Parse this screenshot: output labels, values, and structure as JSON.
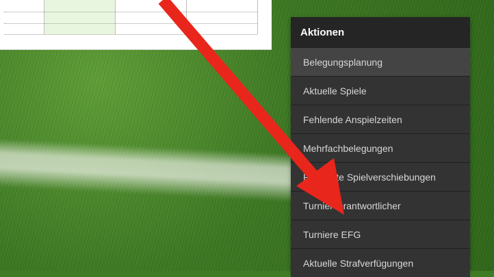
{
  "menu": {
    "title": "Aktionen",
    "items": [
      {
        "label": "Belegungsplanung"
      },
      {
        "label": "Aktuelle Spiele"
      },
      {
        "label": "Fehlende Anspielzeiten"
      },
      {
        "label": "Mehrfachbelegungen"
      },
      {
        "label": "Pendente Spielverschiebungen"
      },
      {
        "label": "Turnierverantwortlicher"
      },
      {
        "label": "Turniere EFG"
      },
      {
        "label": "Aktuelle Strafverfügungen"
      }
    ]
  },
  "annotation": {
    "arrow_color": "#e8261c"
  }
}
